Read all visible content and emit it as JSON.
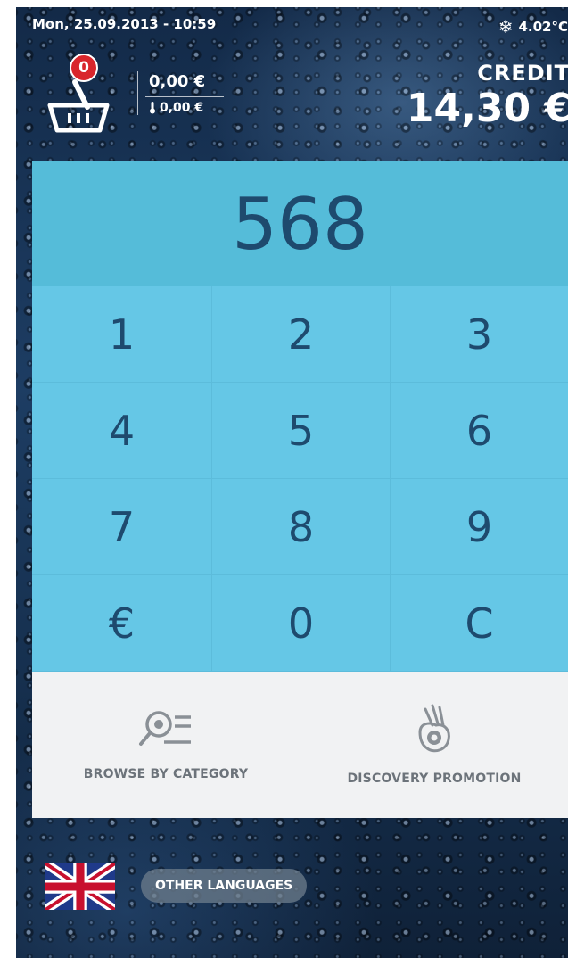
{
  "status": {
    "datetime": "Mon, 25.09.2013 - 10:59",
    "temperature": "4.02°C",
    "temperature_icon": "snowflake-icon"
  },
  "cart": {
    "icon": "basket-icon",
    "item_count": "0",
    "total": "0,00 €",
    "deposit": "0,00 €",
    "deposit_icon": "thermometer-icon"
  },
  "credit": {
    "label": "CREDIT",
    "value": "14,30 €"
  },
  "keypad": {
    "display_value": "568",
    "keys": [
      "1",
      "2",
      "3",
      "4",
      "5",
      "6",
      "7",
      "8",
      "9",
      "€",
      "0",
      "C"
    ]
  },
  "actions": {
    "browse_label": "BROWSE BY CATEGORY",
    "browse_icon": "search-list-icon",
    "discovery_label": "DISCOVERY PROMOTION",
    "discovery_icon": "ok-hand-icon"
  },
  "language": {
    "flag_icon": "uk-flag-icon",
    "other_label": "OTHER LANGUAGES"
  },
  "colors": {
    "display_bg": "#55bcd9",
    "keypad_bg": "#65c7e6",
    "key_text": "#1e4a6e",
    "badge": "#d9262c",
    "actions_bg": "#f1f2f3"
  }
}
